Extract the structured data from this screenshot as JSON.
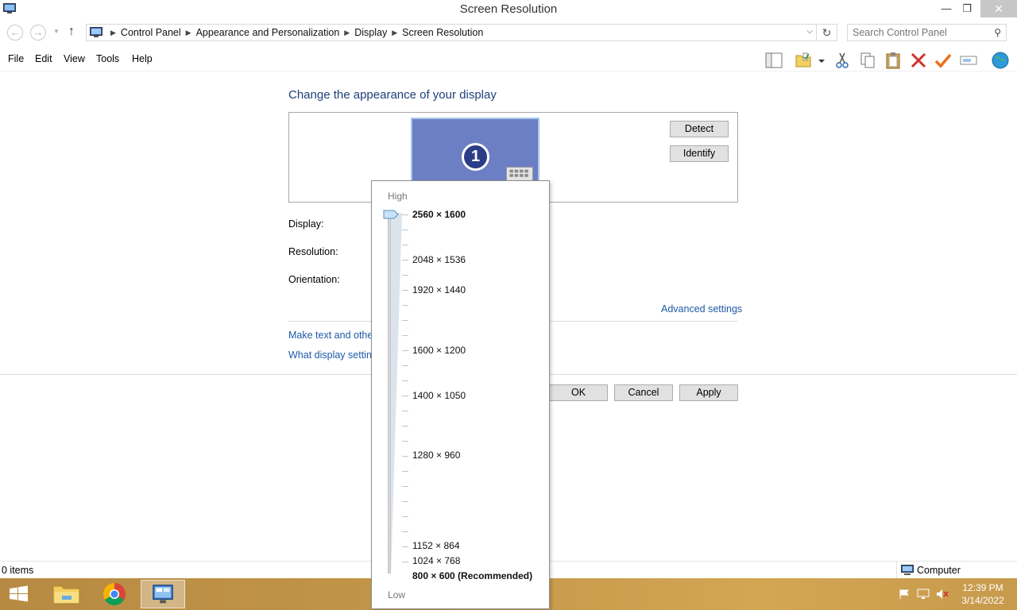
{
  "window": {
    "title": "Screen Resolution",
    "controls": {
      "minimize": "—",
      "maximize": "❐",
      "close": "✕"
    }
  },
  "address": {
    "crumbs": [
      "Control Panel",
      "Appearance and Personalization",
      "Display",
      "Screen Resolution"
    ],
    "search_placeholder": "Search Control Panel"
  },
  "menus": [
    "File",
    "Edit",
    "View",
    "Tools",
    "Help"
  ],
  "main": {
    "heading": "Change the appearance of your display",
    "monitor_number": "1",
    "detect_label": "Detect",
    "identify_label": "Identify",
    "display_label": "Display:",
    "resolution_label": "Resolution:",
    "orientation_label": "Orientation:",
    "advanced_link": "Advanced settings",
    "link_text_size": "Make text and other",
    "link_display_settings": "What display setting",
    "ok_label": "OK",
    "cancel_label": "Cancel",
    "apply_label": "Apply"
  },
  "resolution_popup": {
    "high_label": "High",
    "low_label": "Low",
    "options": [
      {
        "label": "2560 × 1600"
      },
      {
        "label": "2048 × 1536"
      },
      {
        "label": "1920 × 1440"
      },
      {
        "label": "1600 × 1200"
      },
      {
        "label": "1400 × 1050"
      },
      {
        "label": "1280 × 960"
      },
      {
        "label": "1152 × 864"
      },
      {
        "label": "1024 × 768"
      },
      {
        "label": "800 × 600 (Recommended)"
      }
    ],
    "selected": "2560 × 1600"
  },
  "status": {
    "items": "0 items",
    "location": "Computer"
  },
  "taskbar": {
    "time": "12:39 PM",
    "date": "3/14/2022"
  },
  "colors": {
    "heading": "#1e3f7a",
    "link": "#1e5aa8",
    "monitor": "#6d7fc4",
    "taskbar": "#c29648"
  }
}
